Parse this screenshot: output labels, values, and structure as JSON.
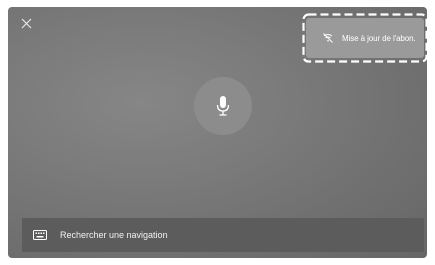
{
  "notification": {
    "label": "Mise à jour de l'abon.",
    "icon": "update-crossed-icon"
  },
  "voice": {
    "icon": "microphone-icon"
  },
  "search": {
    "label": "Rechercher une navigation",
    "icon": "keyboard-icon"
  },
  "close": {
    "icon": "close-icon"
  },
  "colors": {
    "background": "#767676",
    "bar": "#5c5c5c",
    "notice": "#9a9a9a",
    "text": "#ffffff"
  }
}
